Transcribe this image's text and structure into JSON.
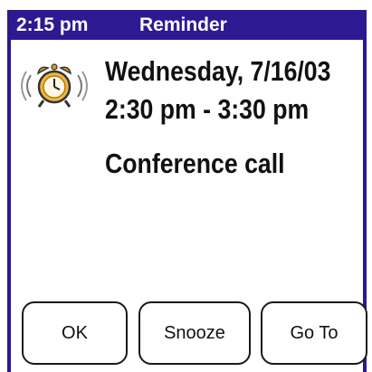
{
  "title_bar": {
    "time": "2:15 pm",
    "title": "Reminder",
    "background_color": "#2d1a92"
  },
  "reminder": {
    "icon": "alarm-clock-icon",
    "date": "Wednesday, 7/16/03",
    "time_range": "2:30 pm - 3:30 pm",
    "description": "Conference call"
  },
  "buttons": {
    "ok_label": "OK",
    "snooze_label": "Snooze",
    "goto_label": "Go To"
  }
}
